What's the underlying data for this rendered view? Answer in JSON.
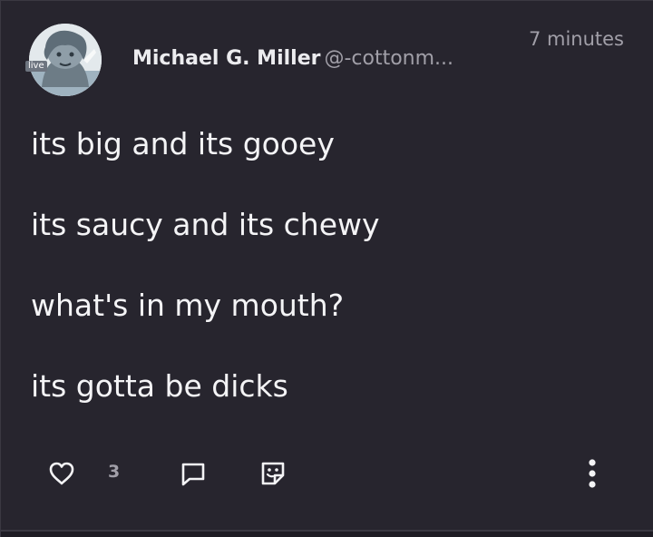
{
  "post": {
    "author": {
      "display_name": "Michael G. Miller",
      "handle": "@-cottonm...",
      "avatar_badge": "live"
    },
    "timestamp": "7 minutes",
    "lines": [
      "its big and its gooey",
      "its saucy and its chewy",
      "what's in my mouth?",
      "its gotta be dicks"
    ],
    "actions": {
      "like_icon": "heart-icon",
      "like_count": "3",
      "comment_icon": "comment-bubble-icon",
      "sticker_icon": "sticker-icon",
      "more_icon": "vertical-ellipsis-icon"
    }
  },
  "colors": {
    "background": "#27252e",
    "text_primary": "#f4f4f6",
    "text_secondary": "#a19fa8",
    "divider": "#3a3842"
  }
}
